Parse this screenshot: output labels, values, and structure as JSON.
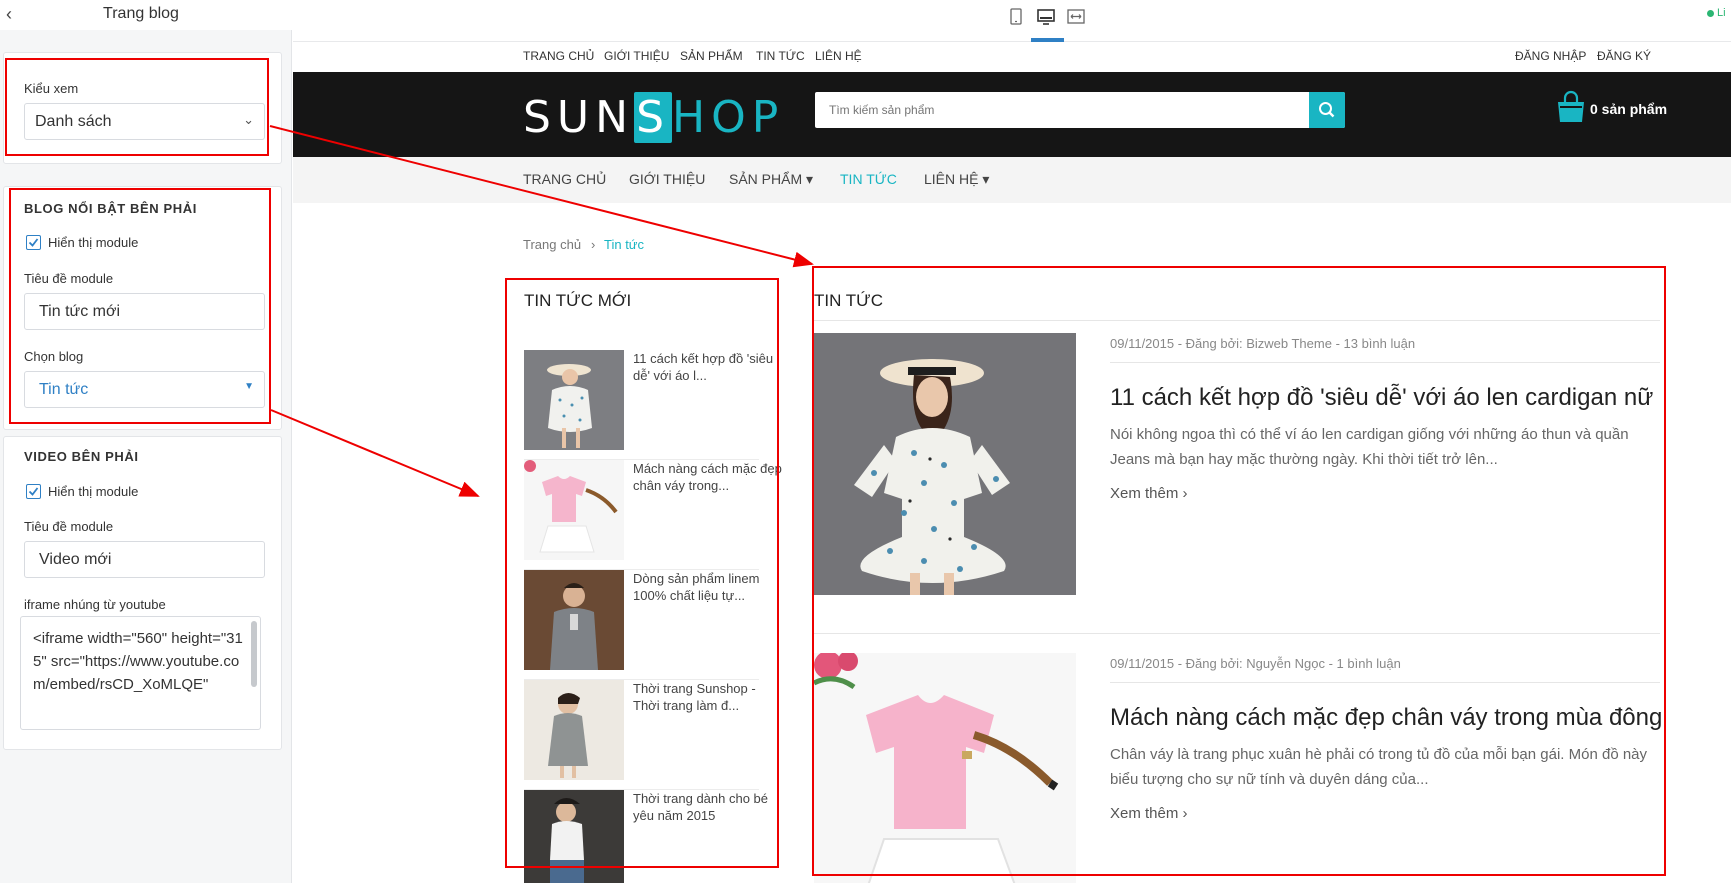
{
  "editor": {
    "title": "Trang blog",
    "view_mode": {
      "label": "Kiểu xem",
      "value": "Danh sách"
    },
    "featured_blog": {
      "section_title": "BLOG NỔI BẬT BÊN PHẢI",
      "show_module_label": "Hiển thị module",
      "show_module_checked": true,
      "module_title_label": "Tiêu đề module",
      "module_title_value": "Tin tức mới",
      "choose_blog_label": "Chọn blog",
      "choose_blog_value": "Tin tức"
    },
    "video": {
      "section_title": "VIDEO BÊN PHẢI",
      "show_module_label": "Hiển thị module",
      "show_module_checked": true,
      "module_title_label": "Tiêu đề module",
      "module_title_value": "Video mới",
      "iframe_label": "iframe nhúng từ youtube",
      "iframe_value": "<iframe width=\"560\" height=\"315\" src=\"https://www.youtube.com/embed/rsCD_XoMLQE\""
    }
  },
  "devbar": {
    "devices": [
      "mobile-icon",
      "desktop-icon",
      "fullwidth-icon"
    ],
    "active": "desktop",
    "live_label": "Li"
  },
  "site": {
    "toplinks": [
      "TRANG CHỦ",
      "GIỚI THIỆU",
      "SẢN PHẨM",
      "TIN TỨC",
      "LIÊN HỆ"
    ],
    "auth": {
      "login": "ĐĂNG NHẬP",
      "register": "ĐĂNG KÝ"
    },
    "logo": {
      "part1": "SUN",
      "part2": "S",
      "part3": "HOP"
    },
    "search_placeholder": "Tìm kiếm sản phẩm",
    "cart_label": "0 sản phẩm",
    "nav": [
      {
        "label": "TRANG CHỦ",
        "active": false
      },
      {
        "label": "GIỚI THIỆU",
        "active": false
      },
      {
        "label": "SẢN PHẨM ▾",
        "active": false
      },
      {
        "label": "TIN TỨC",
        "active": true
      },
      {
        "label": "LIÊN HỆ ▾",
        "active": false
      }
    ],
    "breadcrumb": {
      "home": "Trang chủ",
      "separator": "›",
      "current": "Tin tức"
    },
    "accent_color": "#19b5c3",
    "sidebar": {
      "title": "TIN TỨC MỚI",
      "items": [
        {
          "title": "11 cách kết hợp đồ 'siêu dễ' với áo l..."
        },
        {
          "title": "Mách nàng cách mặc đẹp chân váy trong..."
        },
        {
          "title": "Dòng sản phẩm linem 100% chất liệu tự..."
        },
        {
          "title": "Thời trang Sunshop - Thời trang làm đ..."
        },
        {
          "title": "Thời trang dành cho bé yêu năm 2015"
        }
      ]
    },
    "main": {
      "title": "TIN TỨC",
      "posts": [
        {
          "meta": "09/11/2015 - Đăng bởi: Bizweb Theme - 13 bình luận",
          "title": "11 cách kết hợp đồ 'siêu dễ' với áo len cardigan nữ",
          "excerpt": "Nói không ngoa thì có thể ví áo len cardigan giống với những áo thun và quần Jeans mà bạn hay mặc thường ngày. Khi thời tiết trở lên...",
          "more": "Xem thêm ›"
        },
        {
          "meta": "09/11/2015 - Đăng bởi: Nguyễn Ngọc - 1 bình luận",
          "title": "Mách nàng cách mặc đẹp chân váy trong mùa đông",
          "excerpt": "Chân váy là trang phục xuân hè phải có trong tủ đồ của mỗi bạn gái. Món đồ này biểu tượng cho sự nữ tính và duyên dáng của...",
          "more": "Xem thêm ›"
        }
      ]
    }
  }
}
